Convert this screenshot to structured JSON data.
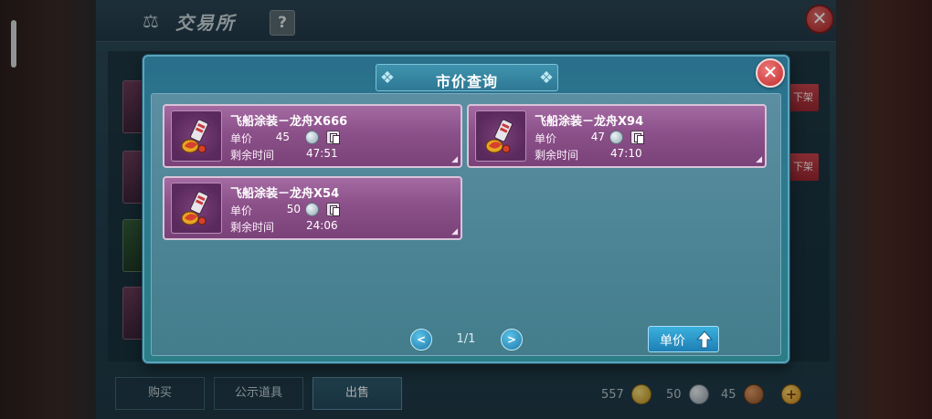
{
  "background": {
    "title": "交易所",
    "help_label": "?",
    "close_label": "✕",
    "unlist_label": "下架",
    "tabs": [
      {
        "label": "购买"
      },
      {
        "label": "公示道具"
      },
      {
        "label": "出售"
      }
    ],
    "currency": [
      {
        "value": "557",
        "icon": "gold-coin-icon"
      },
      {
        "value": "50",
        "icon": "silver-coin-icon"
      },
      {
        "value": "45",
        "icon": "copper-coin-icon"
      }
    ]
  },
  "modal": {
    "title": "市价查询",
    "close_label": "✕",
    "price_label": "单价",
    "time_label": "剩余时间",
    "listings": [
      {
        "name": "飞船涂装－龙舟X666",
        "price": "45",
        "time": "47:51"
      },
      {
        "name": "飞船涂装－龙舟X94",
        "price": "47",
        "time": "47:10"
      },
      {
        "name": "飞船涂装－龙舟X54",
        "price": "50",
        "time": "24:06"
      }
    ],
    "pager": {
      "text": "1/1",
      "prev": "<",
      "next": ">"
    },
    "sort_label": "单价"
  },
  "colors": {
    "modal_frame": "#2a6f8c",
    "card_fill": "#8b5089",
    "close_red": "#c02a2a",
    "button_blue": "#1e7fb5"
  }
}
